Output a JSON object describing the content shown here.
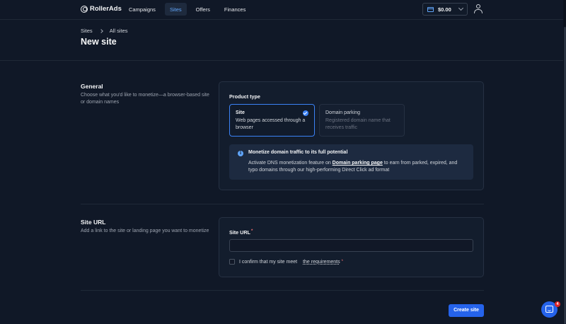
{
  "app": {
    "brand": "RollerAds"
  },
  "nav": {
    "items": [
      {
        "label": "Campaigns",
        "active": false
      },
      {
        "label": "Sites",
        "active": true
      },
      {
        "label": "Offers",
        "active": false
      },
      {
        "label": "Finances",
        "active": false
      }
    ],
    "balance": "$0.00",
    "icons": {
      "wallet": "wallet-icon",
      "balance_menu": "chevron-down-icon",
      "user": "user-icon"
    }
  },
  "breadcrumb": {
    "root": "Sites",
    "current": "All sites"
  },
  "page": {
    "title": "New site"
  },
  "general": {
    "title": "General",
    "description": "Choose what you'd like to monetize—a browser-based site or domain names",
    "product_type_label": "Product type",
    "options": [
      {
        "title": "Site",
        "description": "Web pages accessed through a browser",
        "selected": true
      },
      {
        "title": "Domain parking",
        "description": "Registered domain name that receives traffic",
        "selected": false
      }
    ],
    "info": {
      "title": "Monetize domain traffic to its full potential",
      "text_before": "Activate DNS monetization feature on ",
      "link": "Domain parking page",
      "text_after": " to earn from parked, expired, and typo domains through our high-performing Direct Click ad format"
    }
  },
  "site_url": {
    "title": "Site URL",
    "description": "Add a link to the site or landing page you want to monetize",
    "field_label": "Site URL",
    "required_mark": "*",
    "value": "",
    "confirm_text": "I confirm that my site meet",
    "requirements_link": "the requirements",
    "confirmed": false
  },
  "actions": {
    "create": "Create site"
  },
  "chat": {
    "badge": "4"
  },
  "colors": {
    "accent": "#2563eb",
    "background": "#101827",
    "card": "#131d2d"
  }
}
